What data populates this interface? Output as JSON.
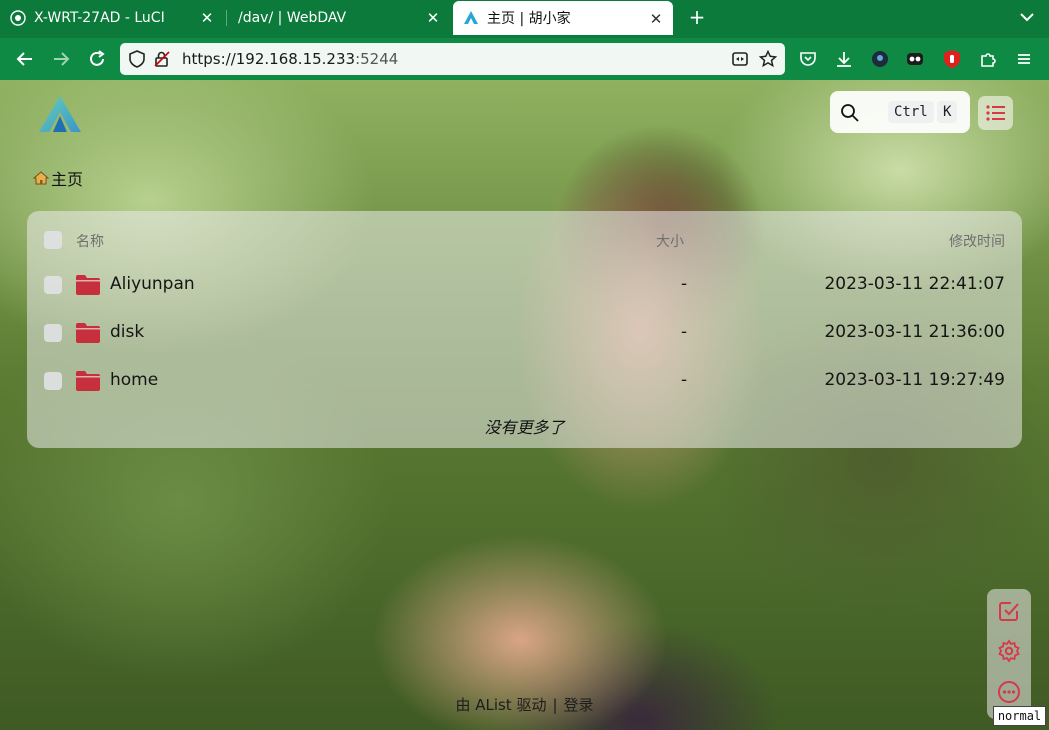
{
  "browser": {
    "tabs": [
      {
        "title": "X-WRT-27AD - LuCI",
        "icon": "router-icon"
      },
      {
        "title": "/dav/ | WebDAV",
        "icon": "none"
      },
      {
        "title": "主页 | 胡小家",
        "icon": "alist-logo",
        "active": true
      }
    ],
    "url": {
      "host": "https://192.168.15.233",
      "port": ":5244"
    },
    "toolbar_icons": [
      "pocket-icon",
      "download-icon",
      "extension-icon",
      "mask-icon",
      "shield-icon",
      "puzzle-icon",
      "menu-icon"
    ],
    "colors": {
      "chrome": "#0b7a3b",
      "urlbar": "#f1f7f3"
    }
  },
  "app": {
    "search": {
      "key1": "Ctrl",
      "key2": "K"
    },
    "breadcrumb": {
      "home": "主页"
    },
    "list": {
      "headers": {
        "name": "名称",
        "size": "大小",
        "modified": "修改时间"
      },
      "rows": [
        {
          "name": "Aliyunpan",
          "size": "-",
          "modified": "2023-03-11 22:41:07"
        },
        {
          "name": "disk",
          "size": "-",
          "modified": "2023-03-11 21:36:00"
        },
        {
          "name": "home",
          "size": "-",
          "modified": "2023-03-11 19:27:49"
        }
      ],
      "end_text": "没有更多了"
    },
    "footer": {
      "powered": "由 AList 驱动",
      "sep": "|",
      "login": "登录"
    },
    "mode_tip": "normal",
    "colors": {
      "accent": "#d9374b",
      "folder": "#c62f3c"
    }
  }
}
